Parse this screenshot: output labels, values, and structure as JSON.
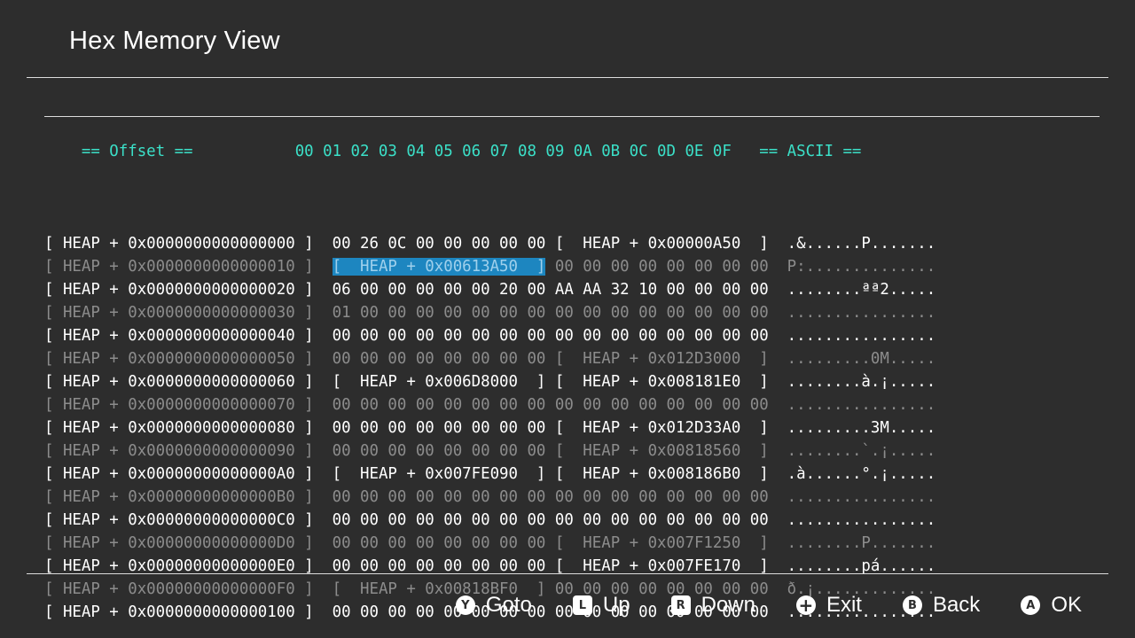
{
  "window": {
    "title": "Hex Memory View"
  },
  "hex_view": {
    "header": {
      "offset": "== Offset ==",
      "columns": "00 01 02 03 04 05 06 07 08 09 0A 0B 0C 0D 0E 0F",
      "ascii": "== ASCII =="
    },
    "rows": [
      {
        "offset": "[ HEAP + 0x0000000000000000 ]",
        "bytes_lo": "00 26 0C 00 00 00 00 00",
        "bytes_hi": "[  HEAP + 0x00000A50  ]",
        "ascii": ".&......P.......",
        "emphasis": "bright"
      },
      {
        "offset": "[ HEAP + 0x0000000000000010 ]",
        "bytes_lo": "[  HEAP + 0x00613A50  ]",
        "bytes_hi": "00 00 00 00 00 00 00 00",
        "ascii": "P:..............",
        "emphasis": "dim",
        "selected": "lo"
      },
      {
        "offset": "[ HEAP + 0x0000000000000020 ]",
        "bytes_lo": "06 00 00 00 00 00 20 00",
        "bytes_hi": "AA AA 32 10 00 00 00 00",
        "ascii": "........ªª2.....",
        "emphasis": "bright"
      },
      {
        "offset": "[ HEAP + 0x0000000000000030 ]",
        "bytes_lo": "01 00 00 00 00 00 00 00",
        "bytes_hi": "00 00 00 00 00 00 00 00",
        "ascii": "................",
        "emphasis": "dim"
      },
      {
        "offset": "[ HEAP + 0x0000000000000040 ]",
        "bytes_lo": "00 00 00 00 00 00 00 00",
        "bytes_hi": "00 00 00 00 00 00 00 00",
        "ascii": "................",
        "emphasis": "bright"
      },
      {
        "offset": "[ HEAP + 0x0000000000000050 ]",
        "bytes_lo": "00 00 00 00 00 00 00 00",
        "bytes_hi": "[  HEAP + 0x012D3000  ]",
        "ascii": ".........0M.....",
        "emphasis": "dim"
      },
      {
        "offset": "[ HEAP + 0x0000000000000060 ]",
        "bytes_lo": "[  HEAP + 0x006D8000  ]",
        "bytes_hi": "[  HEAP + 0x008181E0  ]",
        "ascii": "........à.¡.....",
        "emphasis": "bright"
      },
      {
        "offset": "[ HEAP + 0x0000000000000070 ]",
        "bytes_lo": "00 00 00 00 00 00 00 00",
        "bytes_hi": "00 00 00 00 00 00 00 00",
        "ascii": "................",
        "emphasis": "dim"
      },
      {
        "offset": "[ HEAP + 0x0000000000000080 ]",
        "bytes_lo": "00 00 00 00 00 00 00 00",
        "bytes_hi": "[  HEAP + 0x012D33A0  ]",
        "ascii": ".........3M.....",
        "emphasis": "bright"
      },
      {
        "offset": "[ HEAP + 0x0000000000000090 ]",
        "bytes_lo": "00 00 00 00 00 00 00 00",
        "bytes_hi": "[  HEAP + 0x00818560  ]",
        "ascii": "........`.¡.....",
        "emphasis": "dim"
      },
      {
        "offset": "[ HEAP + 0x00000000000000A0 ]",
        "bytes_lo": "[  HEAP + 0x007FE090  ]",
        "bytes_hi": "[  HEAP + 0x008186B0  ]",
        "ascii": ".à......°.¡.....",
        "emphasis": "bright"
      },
      {
        "offset": "[ HEAP + 0x00000000000000B0 ]",
        "bytes_lo": "00 00 00 00 00 00 00 00",
        "bytes_hi": "00 00 00 00 00 00 00 00",
        "ascii": "................",
        "emphasis": "dim"
      },
      {
        "offset": "[ HEAP + 0x00000000000000C0 ]",
        "bytes_lo": "00 00 00 00 00 00 00 00",
        "bytes_hi": "00 00 00 00 00 00 00 00",
        "ascii": "................",
        "emphasis": "bright"
      },
      {
        "offset": "[ HEAP + 0x00000000000000D0 ]",
        "bytes_lo": "00 00 00 00 00 00 00 00",
        "bytes_hi": "[  HEAP + 0x007F1250  ]",
        "ascii": "........P.......",
        "emphasis": "dim"
      },
      {
        "offset": "[ HEAP + 0x00000000000000E0 ]",
        "bytes_lo": "00 00 00 00 00 00 00 00",
        "bytes_hi": "[  HEAP + 0x007FE170  ]",
        "ascii": "........pá......",
        "emphasis": "bright"
      },
      {
        "offset": "[ HEAP + 0x00000000000000F0 ]",
        "bytes_lo": "[  HEAP + 0x00818BF0  ]",
        "bytes_hi": "00 00 00 00 00 00 00 00",
        "ascii": "ð.¡.............",
        "emphasis": "dim"
      },
      {
        "offset": "[ HEAP + 0x0000000000000100 ]",
        "bytes_lo": "00 00 00 00 00 00 00 00",
        "bytes_hi": "00 00 00 00 00 00 00 00",
        "ascii": "................",
        "emphasis": "bright"
      }
    ]
  },
  "footer": {
    "buttons": [
      {
        "key": "Y",
        "label": "Goto",
        "shape": "round",
        "icon": "y-button-icon"
      },
      {
        "key": "L",
        "label": "Up",
        "shape": "square",
        "icon": "l-button-icon"
      },
      {
        "key": "R",
        "label": "Down",
        "shape": "square",
        "icon": "r-button-icon"
      },
      {
        "key": "+",
        "label": "Exit",
        "shape": "round",
        "icon": "plus-button-icon"
      },
      {
        "key": "B",
        "label": "Back",
        "shape": "round",
        "icon": "b-button-icon"
      },
      {
        "key": "A",
        "label": "OK",
        "shape": "round",
        "icon": "a-button-icon"
      }
    ]
  },
  "colors": {
    "background": "#2d2d2d",
    "header_accent": "#3be0c8",
    "selection": "#1d86c0",
    "dim_text": "#8c8c8c"
  }
}
